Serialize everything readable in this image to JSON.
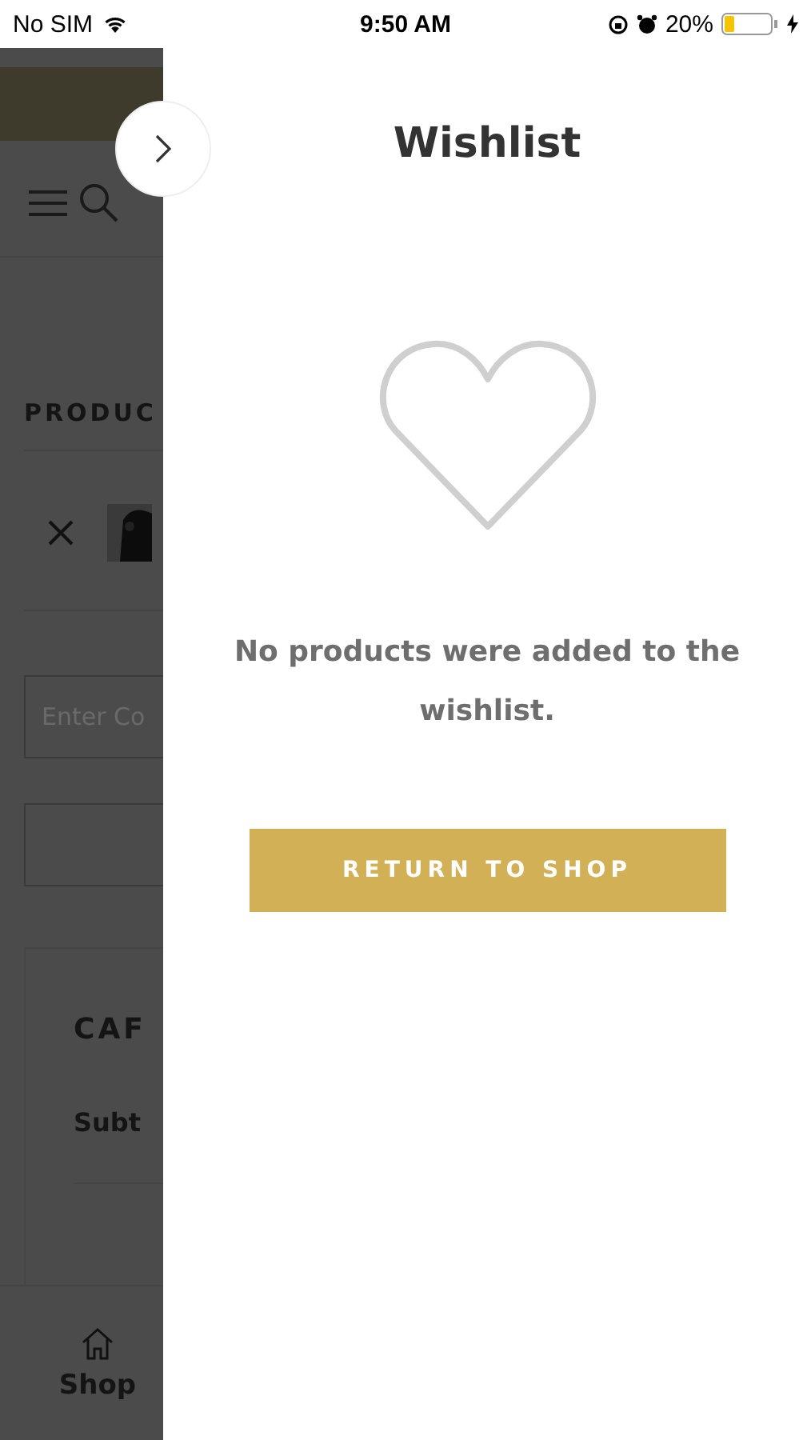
{
  "status_bar": {
    "carrier": "No SIM",
    "time": "9:50 AM",
    "battery": "20%"
  },
  "background_page": {
    "products_heading": "PRODUC",
    "coupon_field": {
      "placeholder": "Enter Co"
    },
    "cart_heading": "CAF",
    "subtotal_label": "Subt",
    "bottom_nav": [
      {
        "label": "Shop"
      }
    ]
  },
  "wishlist_panel": {
    "title": "Wishlist",
    "message": "No products were added to the wishlist.",
    "button": "RETURN TO SHOP"
  }
}
